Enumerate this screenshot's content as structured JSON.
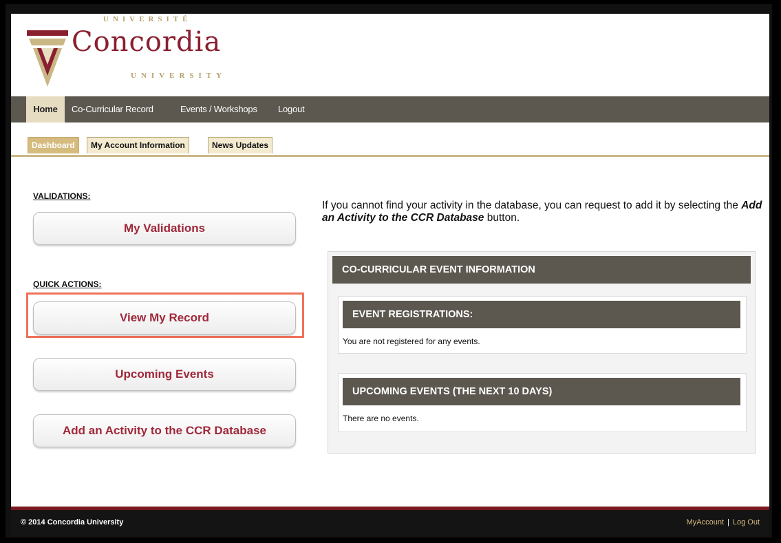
{
  "logo": {
    "top_text": "UNIVERSITÉ",
    "main_text": "Concordia",
    "bottom_text": "UNIVERSITY"
  },
  "nav": {
    "items": [
      {
        "label": "Home",
        "active": true
      },
      {
        "label": "Co-Curricular Record"
      },
      {
        "label": "Events / Workshops"
      },
      {
        "label": "Logout"
      }
    ]
  },
  "tabs": [
    {
      "label": "Dashboard",
      "active": true
    },
    {
      "label": "My Account Information"
    },
    {
      "label": "News Updates"
    }
  ],
  "left": {
    "validations_label": "VALIDATIONS:",
    "validations_button": "My Validations",
    "quick_actions_label": "QUICK ACTIONS:",
    "buttons": [
      "View My Record",
      "Upcoming Events",
      "Add an Activity to the CCR Database"
    ]
  },
  "intro": {
    "prefix": "If you cannot find your activity in the database, you can request to add it by selecting the ",
    "emphasis": "Add an Activity to the CCR Database",
    "suffix": " button."
  },
  "info_panel": {
    "title": "CO-CURRICULAR EVENT INFORMATION",
    "registrations_title": "EVENT REGISTRATIONS:",
    "registrations_msg": "You are not registered for any events.",
    "upcoming_title": "UPCOMING EVENTS  (THE NEXT 10 DAYS)",
    "upcoming_msg": "There are no events."
  },
  "footer": {
    "copyright": "© 2014 Concordia University",
    "my_account": "MyAccount",
    "separator": "|",
    "log_out": "Log Out"
  },
  "colors": {
    "brand_burgundy": "#8a1f2f",
    "gold": "#c9b786",
    "nav_bar": "#5c5850",
    "highlight": "#f0715a"
  }
}
